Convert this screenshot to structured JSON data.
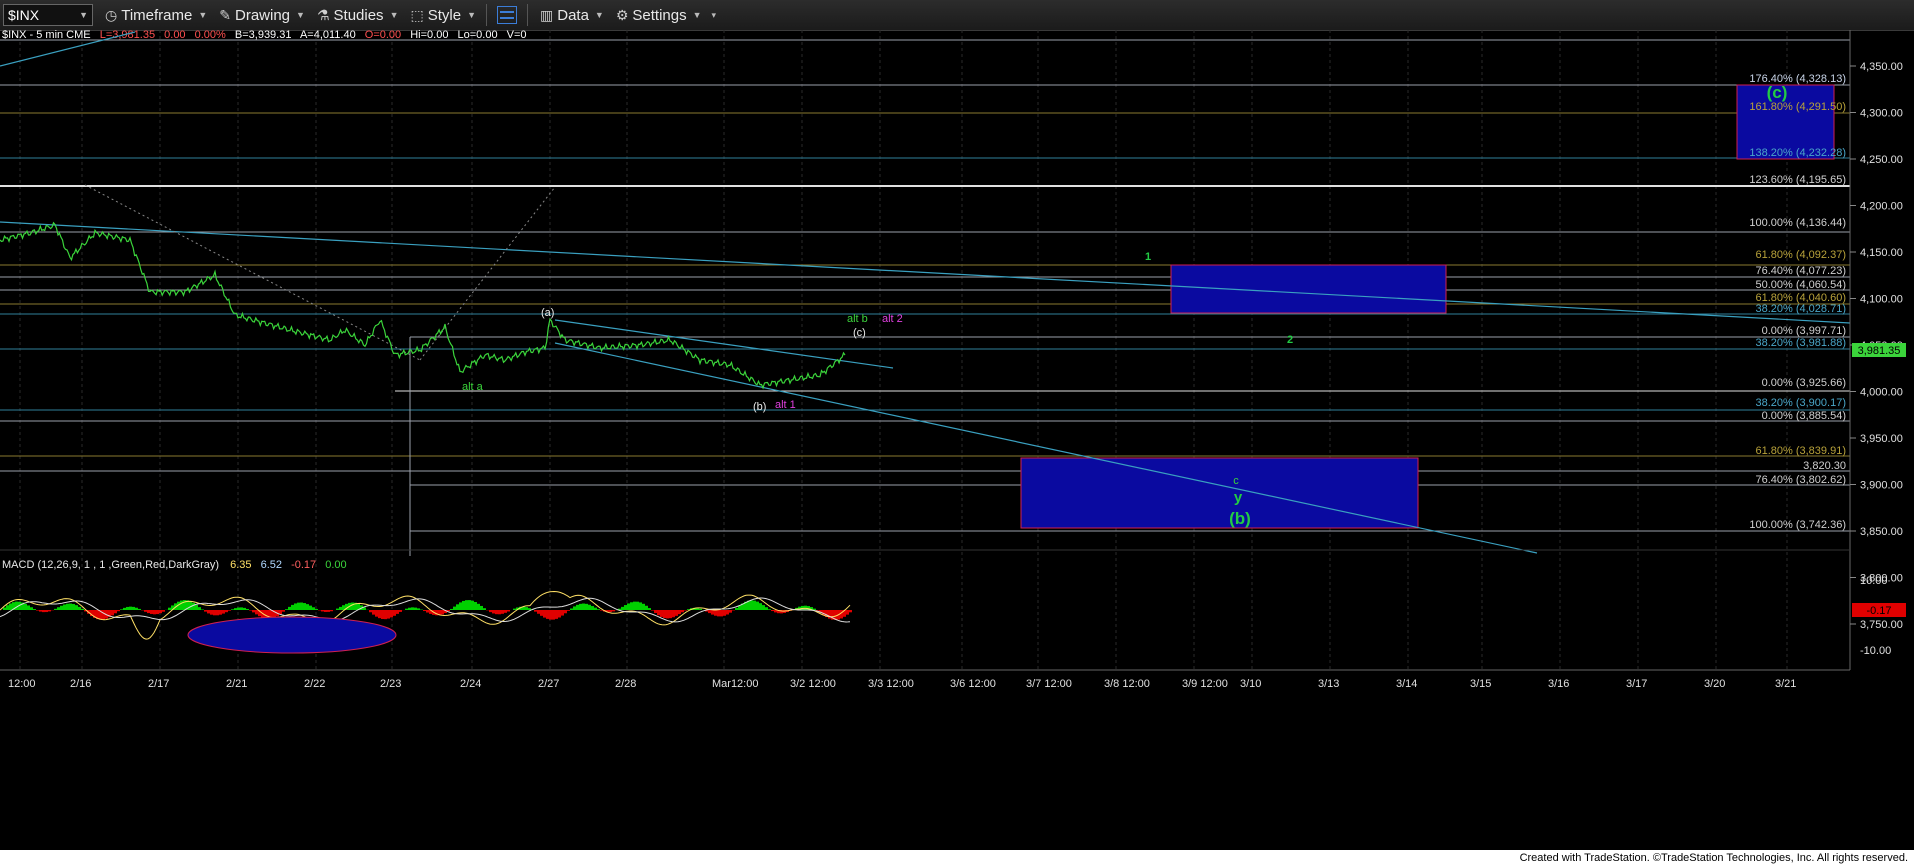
{
  "toolbar": {
    "symbol": "$INX",
    "timeframe": "Timeframe",
    "drawing": "Drawing",
    "studies": "Studies",
    "style": "Style",
    "data": "Data",
    "settings": "Settings"
  },
  "info_bar": {
    "symbol": "$INX - 5 min  CME",
    "last": "L=3,981.35",
    "chg": "0.00",
    "pct": "0.00%",
    "bid": "B=3,939.31",
    "ask": "A=4,011.40",
    "open": "O=0.00",
    "hi": "Hi=0.00",
    "lo": "Lo=0.00",
    "vol": "V=0"
  },
  "macd_header": {
    "label": "MACD (12,26,9, 1 , 1 ,Green,Red,DarkGray)",
    "v1": "6.35",
    "v2": "6.52",
    "v3": "-0.17",
    "v4": "0.00"
  },
  "price_axis": {
    "ticks": [
      "4,350.00",
      "4,300.00",
      "4,250.00",
      "4,200.00",
      "4,150.00",
      "4,100.00",
      "4,050.00",
      "4,000.00",
      "3,950.00",
      "3,900.00",
      "3,850.00",
      "3,800.00",
      "3,750.00"
    ],
    "last_price": "3,981.35"
  },
  "macd_axis": {
    "ticks": [
      "10.00",
      "-10.00"
    ],
    "current": "-0.17"
  },
  "time_axis": {
    "labels": [
      "12:00",
      "2/16",
      "2/17",
      "2/21",
      "2/22",
      "2/23",
      "2/24",
      "2/27",
      "2/28",
      "Mar12:00",
      "3/2 12:00",
      "3/3 12:00",
      "3/6 12:00",
      "3/7 12:00",
      "3/8 12:00",
      "3/9 12:00",
      "3/10",
      "3/13",
      "3/14",
      "3/15",
      "3/16",
      "3/17",
      "3/20",
      "3/21"
    ]
  },
  "fib_levels": [
    {
      "label": "176.40% (4,328.13)",
      "color": "#c8d4e8"
    },
    {
      "label": "161.80% (4,291.50)",
      "color": "#b8a23a"
    },
    {
      "label": "138.20% (4,232.28)",
      "color": "#4aa6c8"
    },
    {
      "label": "123.60% (4,195.65)",
      "color": "#d0d0d0"
    },
    {
      "label": "100.00% (4,136.44)",
      "color": "#d0d0d0"
    },
    {
      "label": "61.80% (4,092.37)",
      "color": "#b8a23a"
    },
    {
      "label": "76.40% (4,077.23)",
      "color": "#d0d0d0"
    },
    {
      "label": "50.00% (4,060.54)",
      "color": "#d0d0d0"
    },
    {
      "label": "61.80% (4,040.60)",
      "color": "#b8a23a"
    },
    {
      "label": "38.20% (4,028.71)",
      "color": "#4aa6c8"
    },
    {
      "label": "0.00% (3,997.71)",
      "color": "#d0d0d0"
    },
    {
      "label": "38.20% (3,981.88)",
      "color": "#4aa6c8"
    },
    {
      "label": "0.00% (3,925.66)",
      "color": "#d0d0d0"
    },
    {
      "label": "38.20% (3,900.17)",
      "color": "#4aa6c8"
    },
    {
      "label": "0.00% (3,885.54)",
      "color": "#d0d0d0"
    },
    {
      "label": "61.80% (3,839.91)",
      "color": "#b8a23a"
    },
    {
      "label": "3,820.30",
      "color": "#d0d0d0"
    },
    {
      "label": "76.40% (3,802.62)",
      "color": "#d0d0d0"
    },
    {
      "label": "100.00% (3,742.36)",
      "color": "#d0d0d0"
    }
  ],
  "wave_labels": {
    "c_big": "(c)",
    "one": "1",
    "two": "2",
    "a_paren": "(a)",
    "alt_b": "alt b",
    "alt_2": "alt 2",
    "c_paren": "(c)",
    "alt_a": "alt a",
    "b_paren": "(b)",
    "alt_1": "alt 1",
    "c_small": "c",
    "y": "y",
    "b_big": "(b)"
  },
  "colors": {
    "price": "#3bd43b",
    "box_fill": "#0a0aa0",
    "box_border": "#d02050",
    "trend": "#3aa0c0",
    "macd_hist_pos": "#00d000",
    "macd_hist_neg": "#e00000"
  },
  "footer": "Created with TradeStation. ©TradeStation Technologies, Inc. All rights reserved."
}
